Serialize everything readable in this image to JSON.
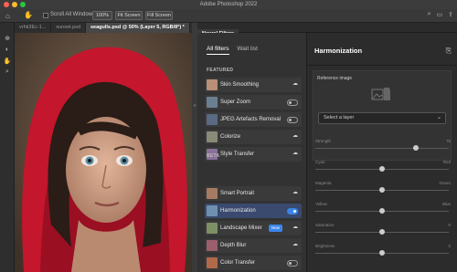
{
  "window": {
    "title": "Adobe Photoshop 2022"
  },
  "options_bar": {
    "scroll_all_label": "Scroll All Windows",
    "zoom_value": "100%",
    "fit_screen_label": "Fit Screen",
    "fill_screen_label": "Fill Screen"
  },
  "doc_tabs": [
    {
      "label": "vrhk3Ec-1..."
    },
    {
      "label": "sunset.psd"
    },
    {
      "label": "seagulls.psd @ 50% (Layer 5, RGB/8*) *",
      "active": true
    }
  ],
  "panel": {
    "header": "Neural Filters",
    "tabs": {
      "all": "All filters",
      "wait": "Wait list"
    },
    "sections": {
      "featured": "FEATURED",
      "beta": "BETA"
    },
    "featured": [
      {
        "name": "Skin Smoothing",
        "control": "cloud",
        "thumb": "#b98f77"
      },
      {
        "name": "Super Zoom",
        "control": "toggle",
        "on": false,
        "thumb": "#6b7f92"
      },
      {
        "name": "JPEG Artefacts Removal",
        "control": "toggle",
        "on": false,
        "thumb": "#5a6a82"
      },
      {
        "name": "Colorize",
        "control": "cloud",
        "thumb": "#8a8a78"
      },
      {
        "name": "Style Transfer",
        "control": "cloud",
        "thumb": "#8a6f9a"
      }
    ],
    "beta": [
      {
        "name": "Smart Portrait",
        "control": "cloud",
        "thumb": "#a67b63"
      },
      {
        "name": "Harmonization",
        "control": "toggle",
        "on": true,
        "selected": true,
        "thumb": "#6f8fb0"
      },
      {
        "name": "Landscape Mixer",
        "control": "cloud",
        "badge": "New",
        "thumb": "#7d8f64"
      },
      {
        "name": "Depth Blur",
        "control": "cloud",
        "thumb": "#9a5f6b"
      },
      {
        "name": "Color Transfer",
        "control": "toggle",
        "on": false,
        "thumb": "#b06a4a"
      }
    ]
  },
  "settings": {
    "title": "Harmonization",
    "reference_label": "Reference image",
    "select_placeholder": "Select a layer",
    "sliders": [
      {
        "label": "Strength",
        "right_label": "75",
        "value": 0.75
      },
      {
        "label": "Cyan",
        "right_label": "Red",
        "value": 0.5
      },
      {
        "label": "Magenta",
        "right_label": "Green",
        "value": 0.5
      },
      {
        "label": "Yellow",
        "right_label": "Blue",
        "value": 0.5
      },
      {
        "label": "Saturation",
        "right_label": "0",
        "value": 0.5
      },
      {
        "label": "Brightness",
        "right_label": "0",
        "value": 0.5
      }
    ]
  },
  "colors": {
    "accent": "#3c85e8",
    "hood": "#c4162c"
  }
}
